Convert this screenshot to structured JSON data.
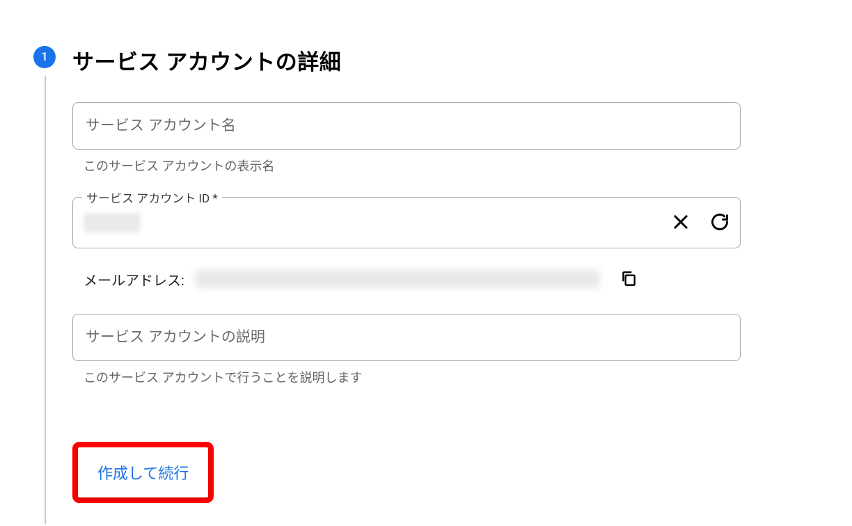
{
  "step": {
    "number": "1",
    "title": "サービス アカウントの詳細"
  },
  "form": {
    "name": {
      "placeholder": "サービス アカウント名",
      "value": "",
      "help": "このサービス アカウントの表示名"
    },
    "id": {
      "label": "サービス アカウント ID *",
      "value": ""
    },
    "email": {
      "label": "メールアドレス:",
      "value": ""
    },
    "description": {
      "placeholder": "サービス アカウントの説明",
      "value": "",
      "help": "このサービス アカウントで行うことを説明します"
    }
  },
  "buttons": {
    "createAndContinue": "作成して続行"
  },
  "icons": {
    "clear": "close-icon",
    "refresh": "refresh-icon",
    "copy": "copy-icon"
  }
}
